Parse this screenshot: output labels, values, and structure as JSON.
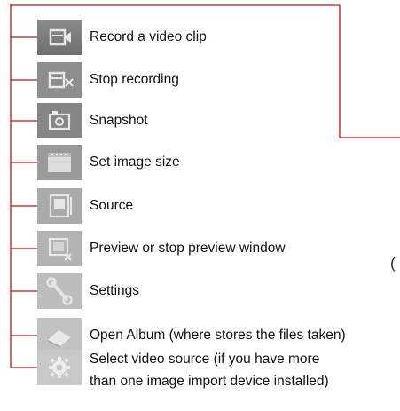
{
  "items": [
    {
      "label": "Record a video clip",
      "icon": "video-camera-icon"
    },
    {
      "label": "Stop recording",
      "icon": "stop-recording-icon"
    },
    {
      "label": "Snapshot",
      "icon": "camera-icon"
    },
    {
      "label": "Set image size",
      "icon": "image-size-icon"
    },
    {
      "label": "Source",
      "icon": "source-icon"
    },
    {
      "label": "Preview or stop preview window",
      "icon": "preview-window-icon"
    },
    {
      "label": "Settings",
      "icon": "wrench-icon"
    },
    {
      "label": "Open Album (where stores the files taken)",
      "icon": "album-icon"
    },
    {
      "label_line1": "Select video source (if you have more",
      "label_line2": "than one image import device installed)",
      "icon": "gear-icon"
    }
  ],
  "edge_glyph": "(",
  "colors": {
    "bracket": "#cc1111",
    "icon_dark": "#7a7a7a",
    "icon_light": "#c4c4c4"
  }
}
